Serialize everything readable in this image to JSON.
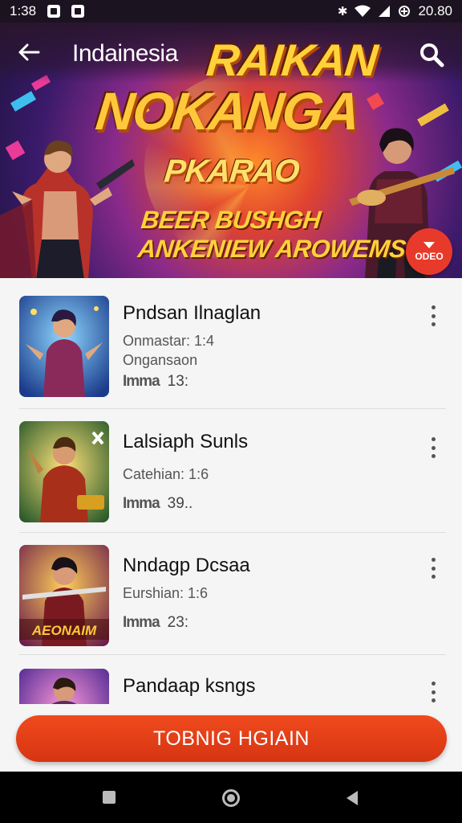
{
  "status_bar": {
    "time": "1:38",
    "right_value": "20.80",
    "icons": [
      "gallery-icon",
      "photo-icon",
      "bluetooth-icon",
      "wifi-icon",
      "signal-icon",
      "data-saver-icon"
    ]
  },
  "header": {
    "title": "Indainesia",
    "back_icon": "arrow-left-icon",
    "search_icon": "search-icon"
  },
  "banner": {
    "line1": "RAIKAN",
    "line2": "NOKANGA",
    "line3": "PKARAO",
    "line4": "BEER BUSHGH",
    "line5": "ANKENIEW AROWEMS",
    "badge_label": "ODEO"
  },
  "list": {
    "items": [
      {
        "title": "Pndsan Ilnaglan",
        "meta1": "Onmastar: 1:4",
        "meta2": "Ongansaon",
        "stat_label": "Imma",
        "stat_value": "13:"
      },
      {
        "title": "Lalsiaph Sunls",
        "meta1": "Catehian: 1:6",
        "stat_label": "Imma",
        "stat_value": "39.."
      },
      {
        "title": "Nndagp Dcsaa",
        "meta1": "Eurshian: 1:6",
        "stat_label": "Imma",
        "stat_value": "23:"
      },
      {
        "title": "Pandaap ksngs"
      }
    ],
    "thumb3_text": "AEONAIM"
  },
  "cta": {
    "label": "TOBNIG HGIAIN"
  },
  "colors": {
    "accent": "#e84118",
    "status_bar_bg": "#1b1420",
    "banner_gold": "#ffd23a"
  }
}
